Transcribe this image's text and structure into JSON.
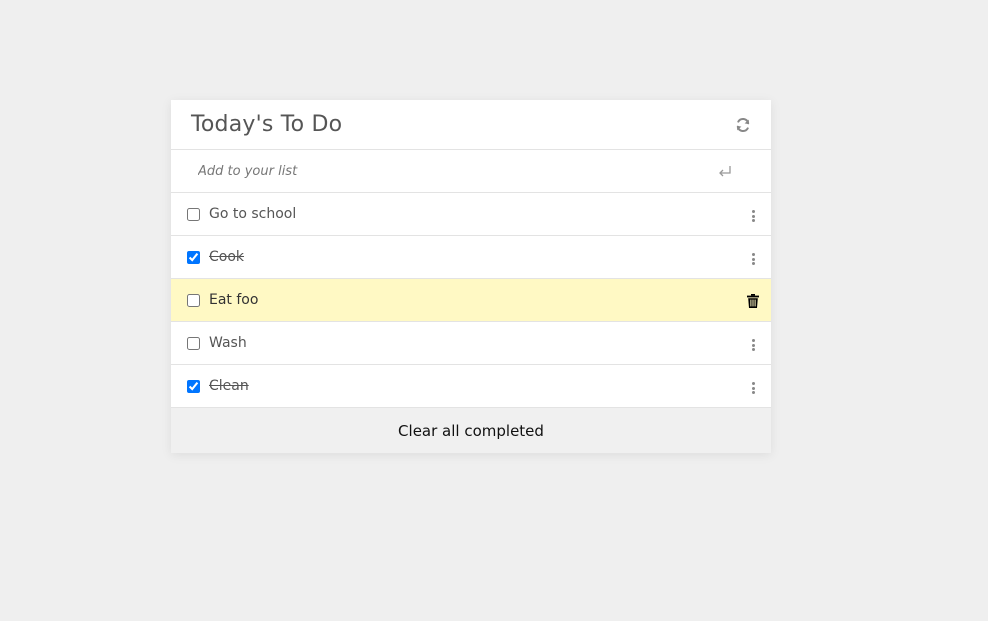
{
  "card": {
    "title": "Today's To Do",
    "refresh_icon": "refresh-icon"
  },
  "add": {
    "placeholder": "Add to your list",
    "value": "",
    "enter_icon": "enter-icon"
  },
  "items": [
    {
      "label": "Go to school",
      "checked": false,
      "action_icon": "kebab-menu-icon"
    },
    {
      "label": "Cook",
      "checked": true,
      "action_icon": "kebab-menu-icon"
    },
    {
      "label": "Eat foo",
      "checked": false,
      "action_icon": "trash-icon",
      "highlighted": true
    },
    {
      "label": "Wash",
      "checked": false,
      "action_icon": "kebab-menu-icon"
    },
    {
      "label": "Clean",
      "checked": true,
      "action_icon": "kebab-menu-icon"
    }
  ],
  "footer": {
    "clear_label": "Clear all completed"
  },
  "colors": {
    "background": "#efefef",
    "highlight": "#fff9c4",
    "checkbox_accent": "#0075ff"
  }
}
